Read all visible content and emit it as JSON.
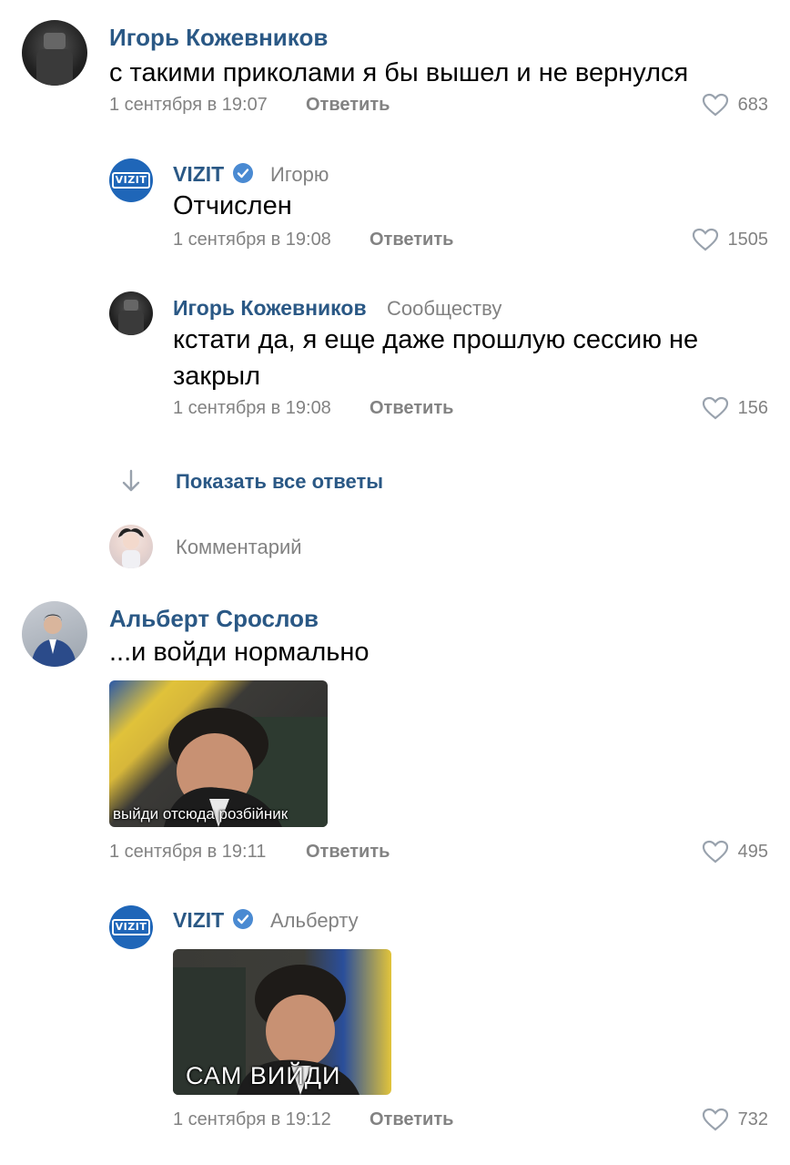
{
  "comments": [
    {
      "author": "Игорь Кожевников",
      "text": "с такими приколами я бы вышел и не вернулся",
      "time": "1 сентября в 19:07",
      "reply_label": "Ответить",
      "likes": "683"
    },
    {
      "author": "VIZIT",
      "addressee": "Игорю",
      "text": "Отчислен",
      "time": "1 сентября в 19:08",
      "reply_label": "Ответить",
      "likes": "1505"
    },
    {
      "author": "Игорь Кожевников",
      "addressee": "Сообществу",
      "text_line1": "кстати да, я еще даже прошлую сессию не",
      "text_line2": "закрыл",
      "time": "1 сентября в 19:08",
      "reply_label": "Ответить",
      "likes": "156"
    },
    {
      "author": "Альберт Срослов",
      "text": "...и войди нормально",
      "gif_caption": "выйди отсюда розбійник",
      "time": "1 сентября в 19:11",
      "reply_label": "Ответить",
      "likes": "495"
    },
    {
      "author": "VIZIT",
      "addressee": "Альберту",
      "gif_caption": "САМ ВИЙДИ",
      "time": "1 сентября в 19:12",
      "reply_label": "Ответить",
      "likes": "732"
    }
  ],
  "show_all_replies": "Показать все ответы",
  "comment_placeholder": "Комментарий",
  "vizit_logo_text": "VIZIT",
  "colors": {
    "author": "#2a5885",
    "meta": "#828282",
    "vizit_blue": "#1f66b8",
    "verified": "#4a8ad2"
  }
}
